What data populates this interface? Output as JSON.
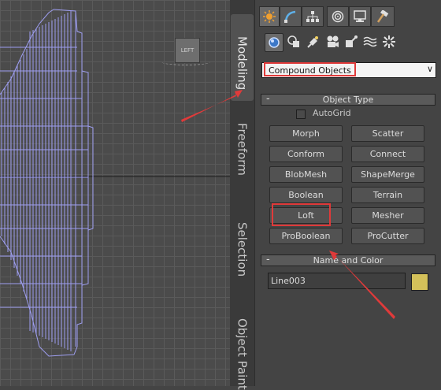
{
  "viewport": {
    "label": "Left",
    "viewcube_label": "LEFT",
    "wire_color": "#9e9ef0",
    "grid_color": "#5a5a5a",
    "bg_color": "#4b4b4b"
  },
  "ribbon": {
    "tabs": [
      {
        "label": "Modeling",
        "active": true
      },
      {
        "label": "Freeform",
        "active": false
      },
      {
        "label": "Selection",
        "active": false
      },
      {
        "label": "Object Paint",
        "active": false
      }
    ]
  },
  "command_panel": {
    "tabs": [
      "create-tab",
      "modify-tab",
      "hierarchy-tab",
      "motion-tab",
      "display-tab",
      "utilities-tab"
    ],
    "subtabs": [
      "geometry-icon",
      "shapes-icon",
      "lights-icon",
      "cameras-icon",
      "helpers-icon",
      "spacewarps-icon",
      "systems-icon"
    ],
    "category_dropdown": {
      "value": "Compound Objects"
    },
    "object_type": {
      "title": "Object Type",
      "toggle": "-",
      "autogrid_label": "AutoGrid",
      "autogrid_checked": false,
      "buttons": [
        "Morph",
        "Scatter",
        "Conform",
        "Connect",
        "BlobMesh",
        "ShapeMerge",
        "Boolean",
        "Terrain",
        "Loft",
        "Mesher",
        "ProBoolean",
        "ProCutter"
      ]
    },
    "name_and_color": {
      "title": "Name and Color",
      "toggle": "-",
      "name_value": "Line003",
      "color": "#d4c15a"
    }
  },
  "annotation_color": "#e03a3a"
}
